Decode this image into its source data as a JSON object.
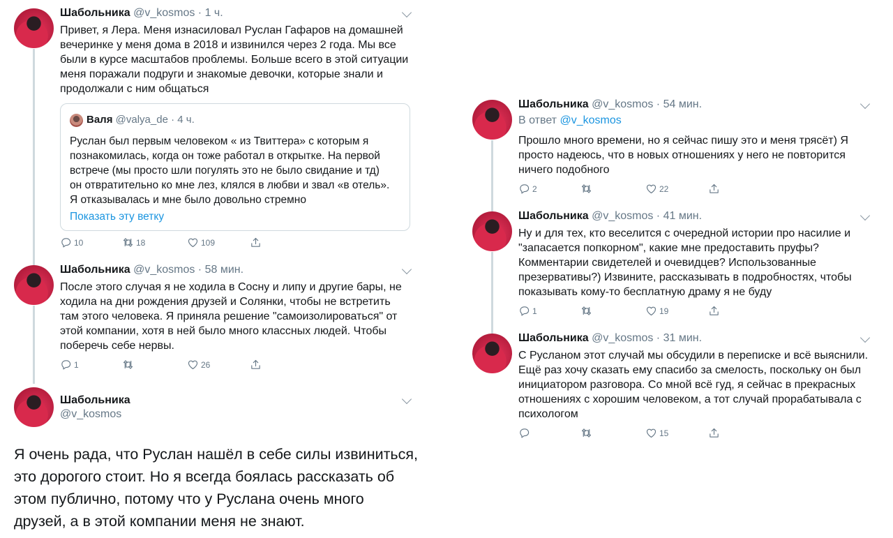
{
  "left": {
    "tweet1": {
      "name": "Шабольника",
      "meta": "@v_kosmos · 1 ч.",
      "lines": [
        "Привет, я Лера. Меня изнасиловал Руслан Гафаров на домашней",
        "вечеринке у меня дома в 2018 и извинился через 2 года. Мы все",
        "были в курсе масштабов проблемы. Больше всего в этой ситуации",
        "меня поражали подруги и знакомые девочки, которые знали и",
        "продолжали с ним общаться"
      ],
      "quote": {
        "name": "Валя",
        "meta": "@valya_de · 4 ч.",
        "lines": [
          "Руслан был первым человеком « из Твиттера» с которым я",
          "познакомилась, когда он тоже работал в открытке. На первой",
          "встрече (мы просто шли погулять это не было свидание и тд)",
          "он отвратительно ко мне лез, клялся в любви и звал «в отель».",
          "Я отказывалась и мне было довольно стремно"
        ],
        "show_thread": "Показать эту ветку"
      },
      "replies": "10",
      "retweets": "18",
      "likes": "109"
    },
    "tweet2": {
      "name": "Шабольника",
      "meta": "@v_kosmos · 58 мин.",
      "lines": [
        "После этого случая я не ходила в Сосну и липу и другие бары, не",
        "ходила на дни рождения друзей и Солянки, чтобы не встретить",
        "там этого человека. Я приняла решение \"самоизолироваться\" от",
        "этой компании, хотя в ней было много классных людей. Чтобы",
        "поберечь себе нервы."
      ],
      "replies": "1",
      "retweets": "",
      "likes": "26"
    },
    "tweet3": {
      "name": "Шабольника",
      "handle": "@v_kosmos",
      "lines": [
        "Я очень рада, что Руслан нашёл в себе силы извиниться,",
        "это дорогого стоит. Но я всегда боялась рассказать об",
        "этом публично, потому что у Руслана очень много",
        "друзей, а в этой компании меня не знают."
      ]
    }
  },
  "right": {
    "tweet1": {
      "name": "Шабольника",
      "meta": "@v_kosmos · 54 мин.",
      "reply_prefix": "В ответ",
      "reply_to": "@v_kosmos",
      "lines": [
        "Прошло много времени, но я сейчас пишу это и меня трясёт) Я",
        "просто надеюсь, что в новых отношениях у него не повторится",
        "ничего подобного"
      ],
      "replies": "2",
      "retweets": "",
      "likes": "22"
    },
    "tweet2": {
      "name": "Шабольника",
      "meta": "@v_kosmos · 41 мин.",
      "lines": [
        "Ну и для тех, кто веселится с очередной истории про насилие и",
        "\"запасается попкорном\", какие мне предоставить пруфы?",
        "Комментарии свидетелей и очевидцев? Использованные",
        "презервативы?) Извините, рассказывать в подробностях, чтобы",
        "показывать кому-то бесплатную драму я не буду"
      ],
      "replies": "1",
      "retweets": "",
      "likes": "19"
    },
    "tweet3": {
      "name": "Шабольника",
      "meta": "@v_kosmos · 31 мин.",
      "lines": [
        "С Русланом этот случай мы обсудили в переписке и всё выяснили.",
        "Ещё раз хочу сказать ему спасибо за смелость, поскольку он был",
        "инициатором разговора. Со мной всё гуд, я сейчас в прекрасных",
        "отношениях с хорошим человеком, а тот случай прорабатывала с",
        "психологом"
      ],
      "replies": "",
      "retweets": "",
      "likes": "15"
    }
  }
}
